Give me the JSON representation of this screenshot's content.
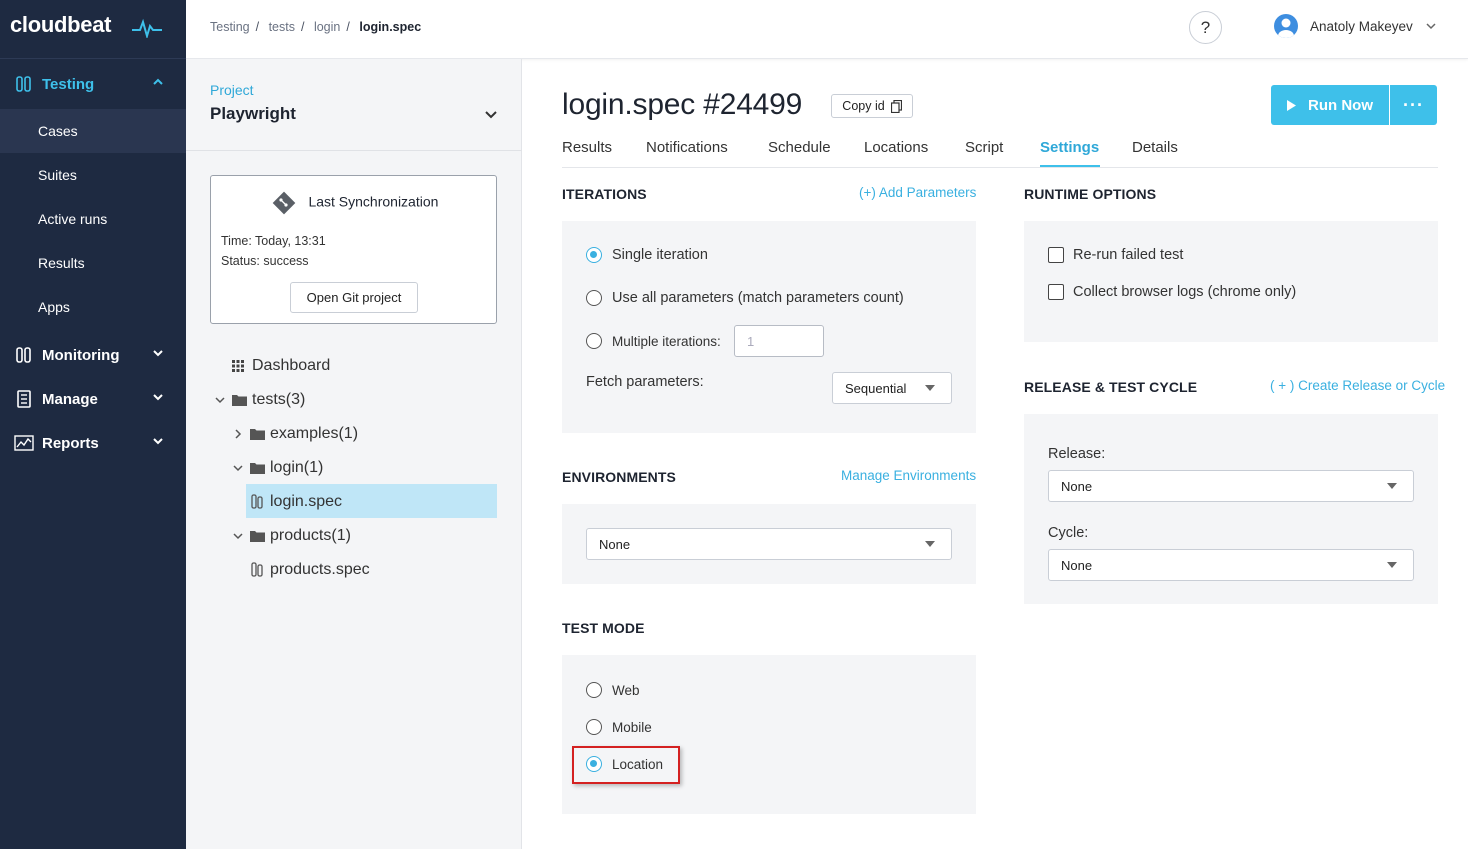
{
  "brand": {
    "logo_text": "cloudbeat",
    "accent": "#3ec0ea",
    "nav_bg": "#1e2a41"
  },
  "nav": {
    "sections": [
      {
        "label": "Testing",
        "icon": "test-tubes-icon",
        "expanded": true
      },
      {
        "label": "Monitoring",
        "icon": "test-tubes-icon",
        "expanded": false
      },
      {
        "label": "Manage",
        "icon": "document-icon",
        "expanded": false
      },
      {
        "label": "Reports",
        "icon": "chart-icon",
        "expanded": false
      }
    ],
    "testing_items": [
      "Cases",
      "Suites",
      "Active runs",
      "Results",
      "Apps"
    ],
    "active_item": "Cases"
  },
  "topbar": {
    "breadcrumbs": [
      "Testing",
      "tests",
      "login",
      "login.spec"
    ],
    "help": "?",
    "user_name": "Anatoly Makeyev"
  },
  "project": {
    "label": "Project",
    "name": "Playwright",
    "sync": {
      "title": "Last Synchronization",
      "time": "Time: Today, 13:31",
      "status": "Status: success",
      "button": "Open Git project"
    },
    "tree": [
      {
        "label": "Dashboard",
        "type": "dashboard"
      },
      {
        "label": "tests(3)",
        "type": "folder",
        "expanded": true
      },
      {
        "label": "examples(1)",
        "type": "folder",
        "expanded": false
      },
      {
        "label": "login(1)",
        "type": "folder",
        "expanded": true
      },
      {
        "label": "login.spec",
        "type": "spec",
        "selected": true
      },
      {
        "label": "products(1)",
        "type": "folder",
        "expanded": true
      },
      {
        "label": "products.spec",
        "type": "spec"
      }
    ]
  },
  "main": {
    "title": "login.spec #24499",
    "copy_id": "Copy id",
    "run_now": "Run Now",
    "more": "···",
    "tabs": [
      "Results",
      "Notifications",
      "Schedule",
      "Locations",
      "Script",
      "Settings",
      "Details"
    ],
    "active_tab": "Settings",
    "iterations": {
      "title": "ITERATIONS",
      "link": "(+) Add Parameters",
      "options": [
        "Single iteration",
        "Use all parameters (match parameters count)",
        "Multiple iterations:"
      ],
      "selected": "Single iteration",
      "multiple_placeholder": "1",
      "fetch_label": "Fetch parameters:",
      "fetch_value": "Sequential"
    },
    "environments": {
      "title": "ENVIRONMENTS",
      "link": "Manage Environments",
      "value": "None"
    },
    "test_mode": {
      "title": "TEST MODE",
      "options": [
        "Web",
        "Mobile",
        "Location"
      ],
      "selected": "Location"
    },
    "runtime": {
      "title": "RUNTIME OPTIONS",
      "options": [
        "Re-run failed test",
        "Collect browser logs (chrome only)"
      ]
    },
    "release": {
      "title": "RELEASE & TEST CYCLE",
      "link": "( + ) Create Release or Cycle",
      "release_label": "Release:",
      "release_value": "None",
      "cycle_label": "Cycle:",
      "cycle_value": "None"
    }
  }
}
